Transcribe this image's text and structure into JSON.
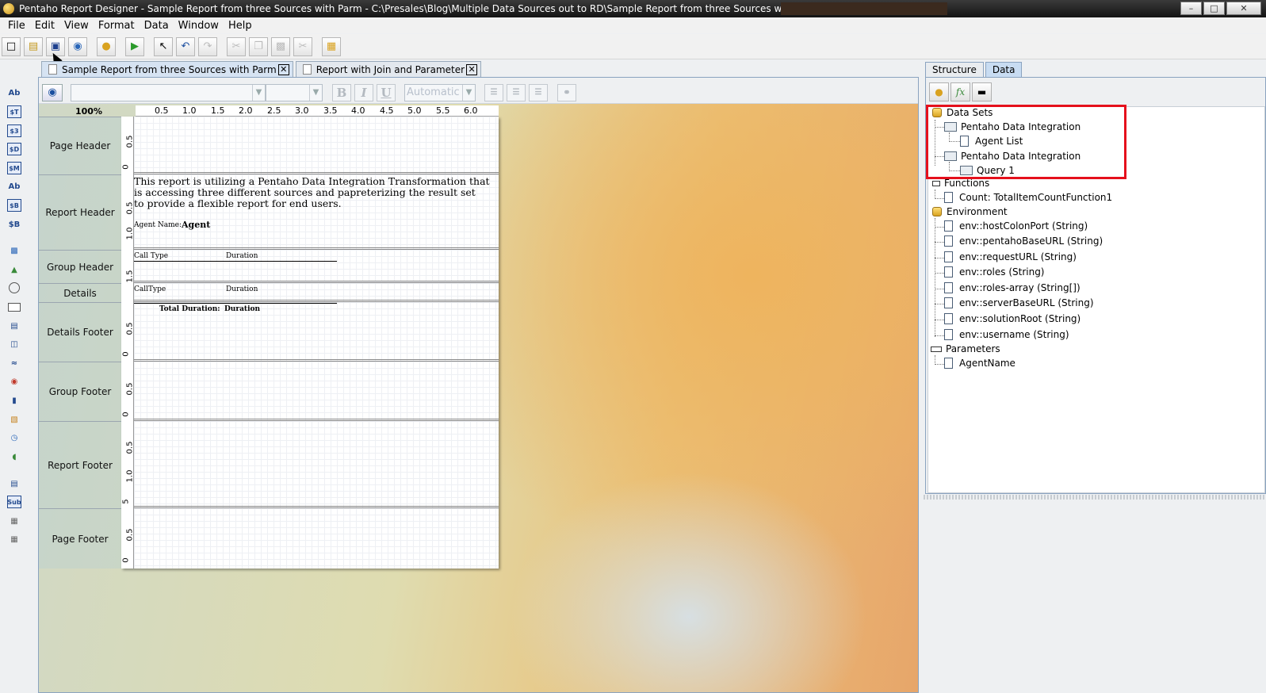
{
  "window": {
    "title": "Pentaho Report Designer - Sample Report from three Sources with Parm - C:\\Presales\\Blog\\Multiple Data Sources out to RD\\Sample Report from three Sources with Parm.prpt",
    "minimize": "–",
    "maximize": "□",
    "close": "✕"
  },
  "menu": [
    "File",
    "Edit",
    "View",
    "Format",
    "Data",
    "Window",
    "Help"
  ],
  "doc_tabs": [
    {
      "label": "Sample Report from three Sources with Parm",
      "close": "✕"
    },
    {
      "label": "Report with Join and Parameter",
      "close": "✕"
    }
  ],
  "format_bar": {
    "font_size_placeholder": "",
    "color_value": "Automatic",
    "bold": "B",
    "italic": "I",
    "underline": "U"
  },
  "zoom": "100%",
  "ruler_ticks": [
    "0.5",
    "1.0",
    "1.5",
    "2.0",
    "2.5",
    "3.0",
    "3.5",
    "4.0",
    "4.5",
    "5.0",
    "5.5",
    "6.0"
  ],
  "bands": [
    {
      "label": "Page Header",
      "ticks": [
        "0.5",
        "0"
      ]
    },
    {
      "label": "Report Header",
      "ticks": [
        "0.5",
        "1.0"
      ]
    },
    {
      "label": "Group Header",
      "ticks": [
        "1.5"
      ]
    },
    {
      "label": "Details",
      "ticks": []
    },
    {
      "label": "Details Footer",
      "ticks": [
        "0.5",
        "0"
      ]
    },
    {
      "label": "Group Footer",
      "ticks": [
        "0.5",
        "0"
      ]
    },
    {
      "label": "Report Footer",
      "ticks": [
        "0.5",
        "1.0",
        "5"
      ]
    },
    {
      "label": "Page Footer",
      "ticks": [
        "0.5",
        "0"
      ]
    }
  ],
  "report": {
    "intro_line1": "This report is utilizing a Pentaho Data Integration Transformation that",
    "intro_line2": " is accessing three different sources and papreterizing the result set",
    "intro_line3": "to provide a flexible report for end users.",
    "agent_label": "Agent Name:",
    "agent_value": "Agent",
    "group_col1": "Call Type",
    "group_col2": "Duration",
    "detail_col1": "CallType",
    "detail_col2": "Duration",
    "total_label": "Total Duration:",
    "total_value": "Duration"
  },
  "right_tabs": [
    "Structure",
    "Data"
  ],
  "right_toolbar": {
    "func": "fx"
  },
  "tree": {
    "data_sets": "Data Sets",
    "pdi1": "Pentaho Data Integration",
    "agent_list": "Agent List",
    "pdi2": "Pentaho Data Integration",
    "query1": "Query 1",
    "functions": "Functions",
    "count_fn": "Count: TotalItemCountFunction1",
    "environment": "Environment",
    "env": [
      "env::hostColonPort (String)",
      "env::pentahoBaseURL (String)",
      "env::requestURL (String)",
      "env::roles (String)",
      "env::roles-array (String[])",
      "env::serverBaseURL (String)",
      "env::solutionRoot (String)",
      "env::username (String)"
    ],
    "parameters": "Parameters",
    "agent_name": "AgentName"
  },
  "palette_labels": [
    "Ab",
    "$T",
    "$3",
    "$D",
    "$M",
    "Ab",
    "$B",
    "$B",
    "Sub"
  ],
  "colors": {
    "highlight": "#e5101c",
    "tab_active": "#c8dcf2"
  }
}
